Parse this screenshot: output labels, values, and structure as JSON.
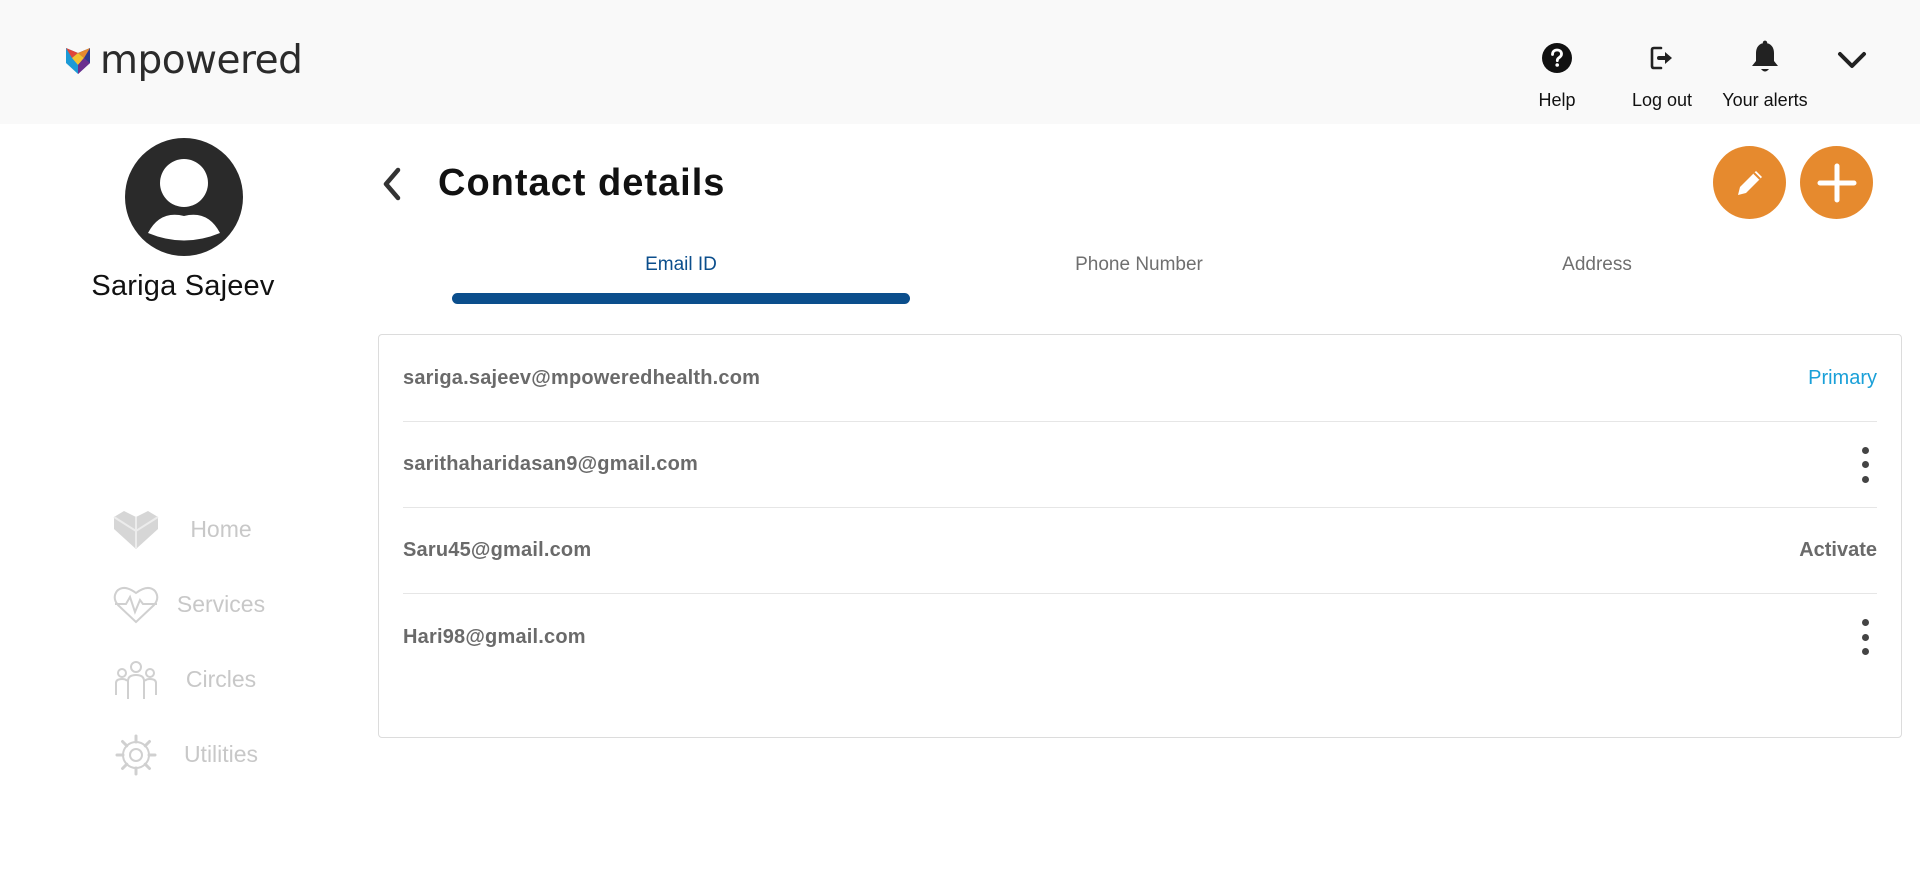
{
  "app": {
    "brand": "mpowered",
    "accent_color": "#e68a2e",
    "tab_active_color": "#0b4e8c",
    "primary_badge_color": "#1aa0d8"
  },
  "header": {
    "actions": [
      {
        "label": "Help",
        "icon": "help-circle-icon"
      },
      {
        "label": "Log out",
        "icon": "logout-icon"
      },
      {
        "label": "Your alerts",
        "icon": "bell-icon"
      }
    ],
    "menu_icon": "chevron-down-icon"
  },
  "profile": {
    "name": "Sariga Sajeev",
    "avatar_icon": "user-avatar-icon"
  },
  "sidebar": {
    "items": [
      {
        "label": "Home",
        "icon": "heart-home-icon"
      },
      {
        "label": "Services",
        "icon": "heart-pulse-icon"
      },
      {
        "label": "Circles",
        "icon": "people-icon"
      },
      {
        "label": "Utilities",
        "icon": "gear-wrench-icon"
      }
    ]
  },
  "page": {
    "title": "Contact details",
    "back_icon": "chevron-left-icon",
    "edit_icon": "pencil-icon",
    "add_icon": "plus-icon"
  },
  "tabs": [
    {
      "label": "Email ID",
      "active": true
    },
    {
      "label": "Phone Number",
      "active": false
    },
    {
      "label": "Address",
      "active": false
    }
  ],
  "emails": [
    {
      "address": "sariga.sajeev@mpoweredhealth.com",
      "status": "Primary"
    },
    {
      "address": "sarithaharidasan9@gmail.com",
      "status": ""
    },
    {
      "address": "Saru45@gmail.com",
      "status": "Activate"
    },
    {
      "address": "Hari98@gmail.com",
      "status": ""
    }
  ]
}
